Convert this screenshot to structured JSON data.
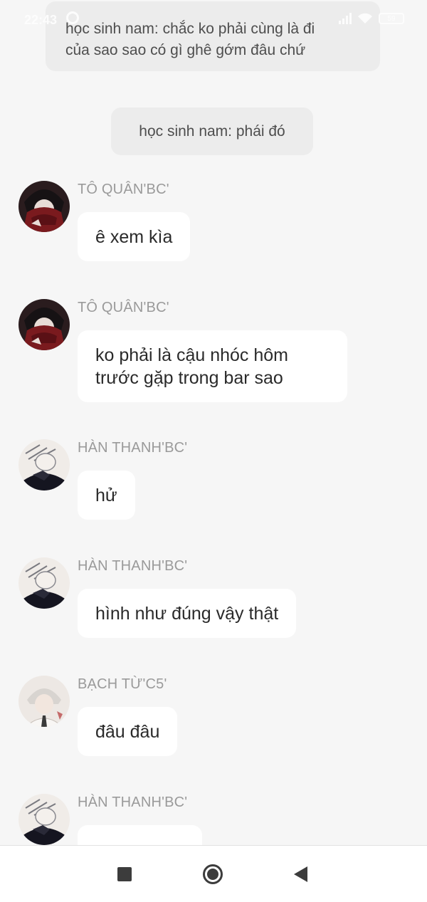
{
  "status_bar": {
    "time": "22:43",
    "battery": "59"
  },
  "narrations": [
    {
      "text_line1": "học sinh nam: chắc ko phải cùng là đi",
      "text_line2": "của sao sao có gì ghê gớm đâu chứ"
    },
    {
      "text": "học sinh nam: phái đó"
    }
  ],
  "messages": [
    {
      "sender": "TÔ QUÂN'BC'",
      "text": "ê xem kìa",
      "avatar": "avatar-red-scarf"
    },
    {
      "sender": "TÔ QUÂN'BC'",
      "text_line1": "ko phải là cậu nhóc hôm",
      "text_line2": "trước gặp trong bar sao",
      "avatar": "avatar-red-scarf"
    },
    {
      "sender": "HÀN THANH'BC'",
      "text": "hử",
      "avatar": "avatar-sketch"
    },
    {
      "sender": "HÀN THANH'BC'",
      "text": "hình như đúng vậy thật",
      "avatar": "avatar-sketch"
    },
    {
      "sender": "BẠCH TỪ'C5'",
      "text": "đâu đâu",
      "avatar": "avatar-white-hair"
    },
    {
      "sender": "HÀN THANH'BC'",
      "text": "",
      "avatar": "avatar-sketch"
    }
  ],
  "nav": {
    "buttons": [
      "recents",
      "home",
      "back"
    ]
  },
  "colors": {
    "background": "#f6f6f6",
    "narration_bg": "#ececec",
    "bubble_bg": "#ffffff",
    "sender_text": "#9a9a9a"
  }
}
